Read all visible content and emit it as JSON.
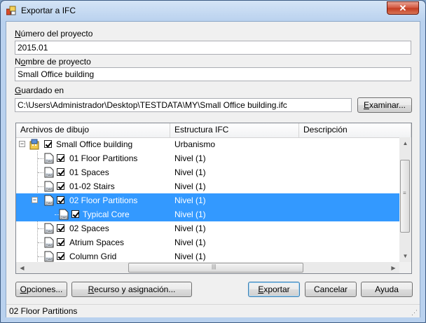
{
  "window": {
    "title": "Exportar a IFC",
    "close_label": "✕",
    "app_icon": "app-icon",
    "colors": {
      "selection": "#3399ff",
      "titlebar": "#b9d1ee",
      "close": "#c33b20"
    }
  },
  "project": {
    "number_label_accel": "N",
    "number_label_rest": "úmero del proyecto",
    "number_value": "2015.01",
    "name_label_pre": "N",
    "name_label_accel": "o",
    "name_label_rest": "mbre de proyecto",
    "name_value": "Small Office building",
    "saved_label_accel": "G",
    "saved_label_rest": "uardado en",
    "saved_value": "C:\\Users\\Administrador\\Desktop\\TESTDATA\\MY\\Small Office building.ifc",
    "browse_accel": "E",
    "browse_rest": "xaminar..."
  },
  "tree": {
    "columns": [
      "Archivos de dibujo",
      "Estructura IFC",
      "Descripción"
    ],
    "root": {
      "label": "Small Office building",
      "structure": "Urbanismo",
      "checked": true,
      "icon": "building-icon"
    },
    "items": [
      {
        "label": "01 Floor Partitions",
        "structure": "Nivel (1)",
        "checked": true,
        "icon": "dwg-icon",
        "selected": false
      },
      {
        "label": "01 Spaces",
        "structure": "Nivel (1)",
        "checked": true,
        "icon": "dwg-icon",
        "selected": false
      },
      {
        "label": "01-02 Stairs",
        "structure": "Nivel (1)",
        "checked": true,
        "icon": "dwg-icon",
        "selected": false
      },
      {
        "label": "02 Floor Partitions",
        "structure": "Nivel (1)",
        "checked": true,
        "icon": "dwg-icon",
        "selected": true,
        "expanded": true
      },
      {
        "label": "Typical Core",
        "structure": "Nivel (1)",
        "checked": true,
        "icon": "dwg-icon",
        "selected": true
      },
      {
        "label": "02 Spaces",
        "structure": "Nivel (1)",
        "checked": true,
        "icon": "dwg-icon",
        "selected": false
      },
      {
        "label": "Atrium Spaces",
        "structure": "Nivel (1)",
        "checked": true,
        "icon": "dwg-icon",
        "selected": false
      },
      {
        "label": "Column Grid",
        "structure": "Nivel (1)",
        "checked": true,
        "icon": "dwg-icon",
        "selected": false
      }
    ]
  },
  "buttons": {
    "options_accel": "O",
    "options_rest": "pciones...",
    "resource_pre": "",
    "resource_accel": "R",
    "resource_rest": "ecurso y asignación...",
    "export_pre": "",
    "export_accel": "E",
    "export_rest": "xportar",
    "cancel": "Cancelar",
    "help": "Ayuda"
  },
  "status": {
    "text": "02 Floor Partitions"
  }
}
